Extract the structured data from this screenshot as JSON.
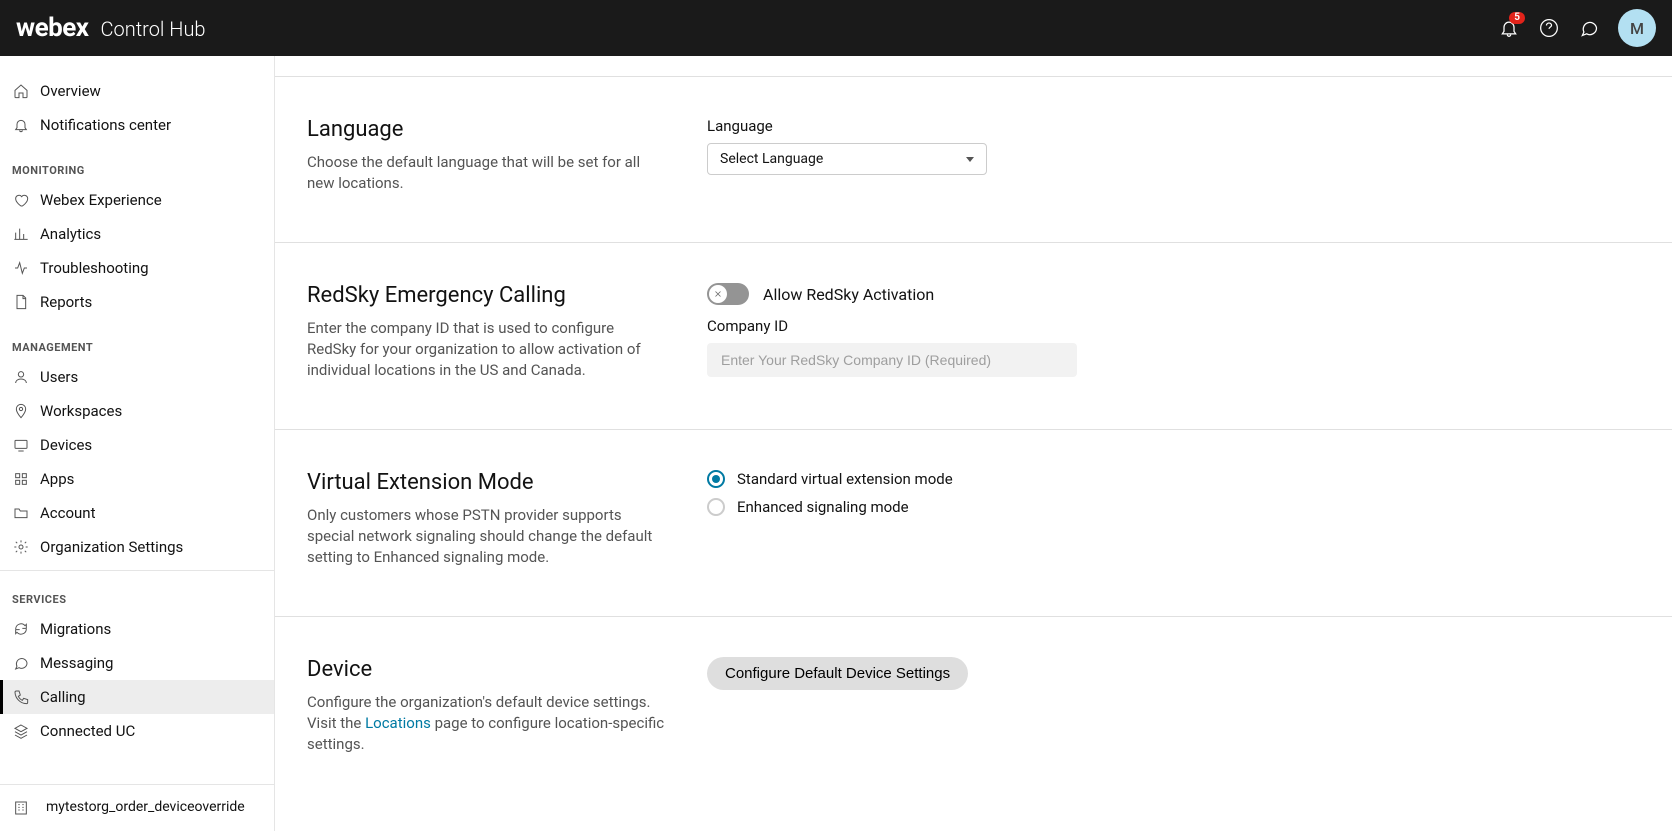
{
  "header": {
    "logo": "webex",
    "sub": "Control Hub",
    "notif_count": "5",
    "avatar_initial": "M"
  },
  "sidebar": {
    "top_items": [
      {
        "label": "Overview",
        "icon": "home"
      },
      {
        "label": "Notifications center",
        "icon": "bell"
      }
    ],
    "sections": [
      {
        "label": "MONITORING",
        "items": [
          {
            "label": "Webex Experience",
            "icon": "heart"
          },
          {
            "label": "Analytics",
            "icon": "chart"
          },
          {
            "label": "Troubleshooting",
            "icon": "pulse"
          },
          {
            "label": "Reports",
            "icon": "doc"
          }
        ]
      },
      {
        "label": "MANAGEMENT",
        "items": [
          {
            "label": "Users",
            "icon": "user"
          },
          {
            "label": "Workspaces",
            "icon": "pin"
          },
          {
            "label": "Devices",
            "icon": "device"
          },
          {
            "label": "Apps",
            "icon": "grid"
          },
          {
            "label": "Account",
            "icon": "folder"
          },
          {
            "label": "Organization Settings",
            "icon": "gear"
          }
        ]
      },
      {
        "label": "SERVICES",
        "items": [
          {
            "label": "Migrations",
            "icon": "refresh"
          },
          {
            "label": "Messaging",
            "icon": "chat"
          },
          {
            "label": "Calling",
            "icon": "phone",
            "active": true
          },
          {
            "label": "Connected UC",
            "icon": "stack"
          }
        ]
      }
    ],
    "footer_text": "mytestorg_order_deviceoverride"
  },
  "sections": {
    "language": {
      "title": "Language",
      "desc": "Choose the default language that will be set for all new locations.",
      "field_label": "Language",
      "select_placeholder": "Select Language"
    },
    "redsky": {
      "title": "RedSky Emergency Calling",
      "desc": "Enter the company ID that is used to configure RedSky for your organization to allow activation of individual locations in the US and Canada.",
      "toggle_label": "Allow RedSky Activation",
      "company_id_label": "Company ID",
      "company_id_placeholder": "Enter Your RedSky Company ID (Required)"
    },
    "vext": {
      "title": "Virtual Extension Mode",
      "desc": "Only customers whose PSTN provider supports special network signaling should change the default setting to Enhanced signaling mode.",
      "option_standard": "Standard virtual extension mode",
      "option_enhanced": "Enhanced signaling mode"
    },
    "device": {
      "title": "Device",
      "desc_prefix": "Configure the organization's default device settings. Visit the ",
      "desc_link": "Locations",
      "desc_suffix": " page to configure location-specific settings.",
      "button": "Configure Default Device Settings"
    }
  }
}
